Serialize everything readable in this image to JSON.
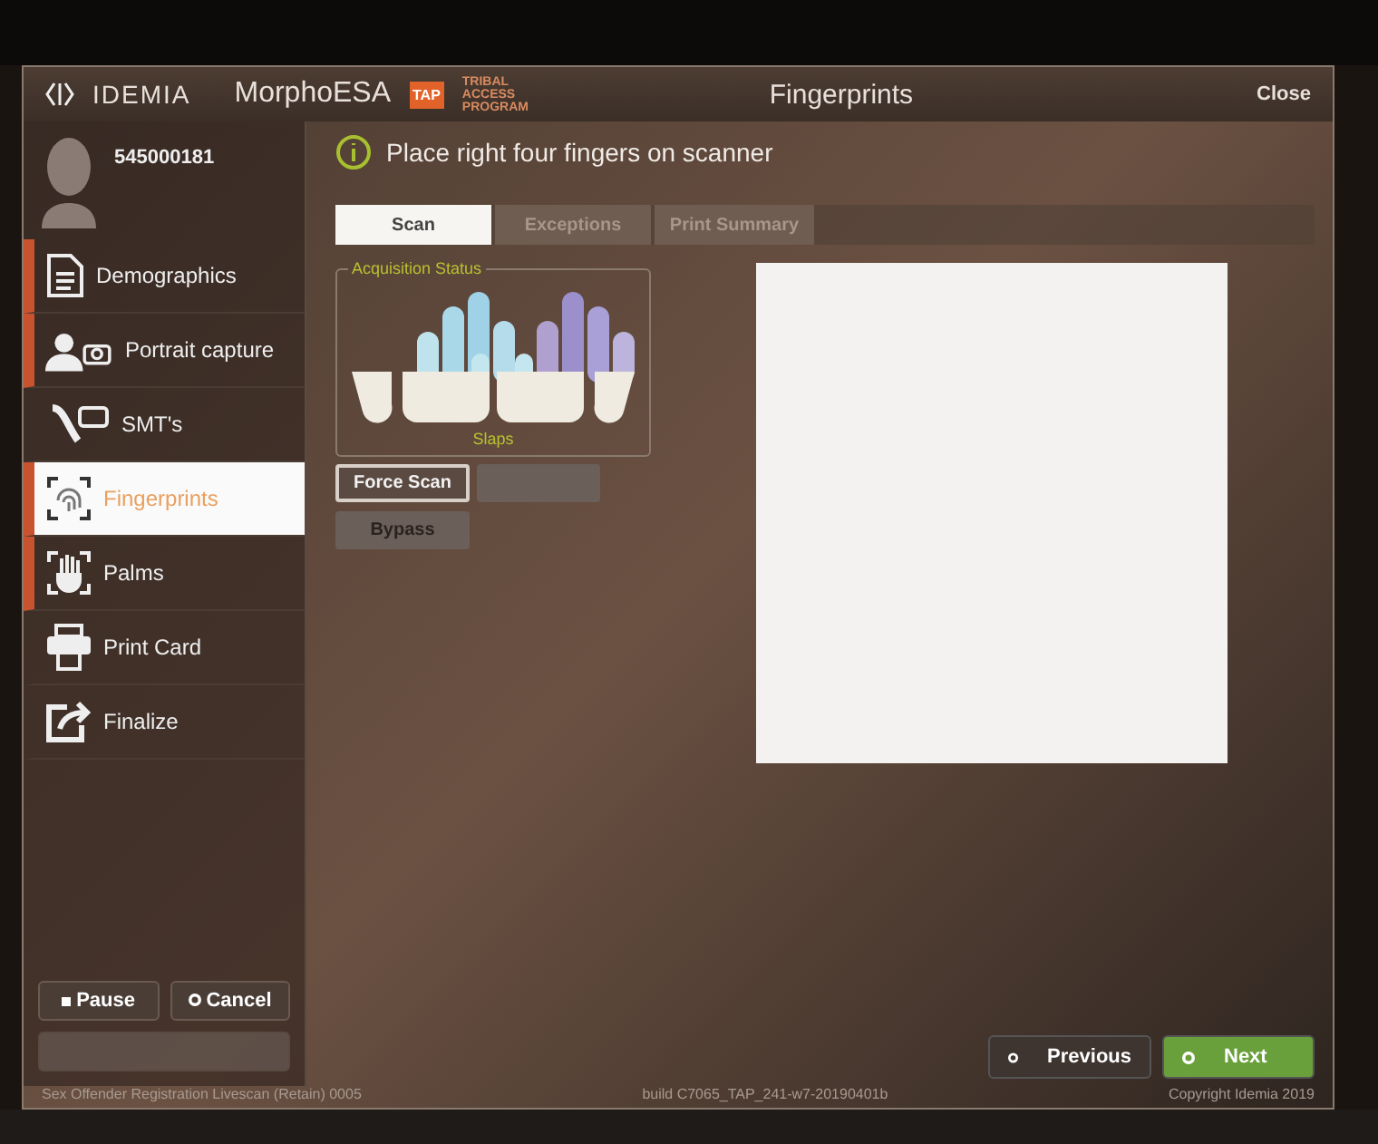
{
  "title_bar": {
    "brand": "IDEMIA",
    "app": "MorphoESA",
    "badge": "TAP",
    "program": "TRIBAL ACCESS PROGRAM",
    "title": "Fingerprints",
    "close": "Close"
  },
  "subject": {
    "id": "545000181"
  },
  "sidebar": {
    "items": [
      {
        "label": "Demographics",
        "kind": "document",
        "flagged": true,
        "selected": false
      },
      {
        "label": "Portrait capture",
        "kind": "portrait",
        "flagged": true,
        "selected": false
      },
      {
        "label": "SMT's",
        "kind": "tattoo",
        "flagged": false,
        "selected": false
      },
      {
        "label": "Fingerprints",
        "kind": "fingerprint",
        "flagged": true,
        "selected": true
      },
      {
        "label": "Palms",
        "kind": "palm",
        "flagged": true,
        "selected": false
      },
      {
        "label": "Print Card",
        "kind": "printer",
        "flagged": false,
        "selected": false
      },
      {
        "label": "Finalize",
        "kind": "share",
        "flagged": false,
        "selected": false
      }
    ],
    "buttons": [
      {
        "label": "Pause",
        "kind": "pause",
        "disabled": false
      },
      {
        "label": "Cancel",
        "kind": "cancel",
        "disabled": false
      },
      {
        "kind": "done",
        "disabled": true
      }
    ]
  },
  "prompt": "Place right four fingers on scanner",
  "tabs": [
    {
      "label": "Scan",
      "selected": true
    },
    {
      "label": "Exceptions",
      "selected": false
    },
    {
      "label": "Print Summary",
      "selected": false
    }
  ],
  "acquisition": {
    "legend": "Acquisition Status",
    "caption": "Slaps"
  },
  "actions": [
    {
      "label": "Force Scan",
      "disabled": false
    },
    {
      "disabled": true
    },
    {
      "label": "Bypass",
      "disabled": true
    }
  ],
  "navigation": [
    {
      "label": "Previous",
      "kind": "secondary"
    },
    {
      "label": "Next",
      "kind": "primary"
    }
  ],
  "status_bar": {
    "left": "Sex Offender Registration Livescan (Retain) 0005",
    "center": "build C7065_TAP_241-w7-20190401b",
    "right": "Copyright Idemia 2019"
  }
}
